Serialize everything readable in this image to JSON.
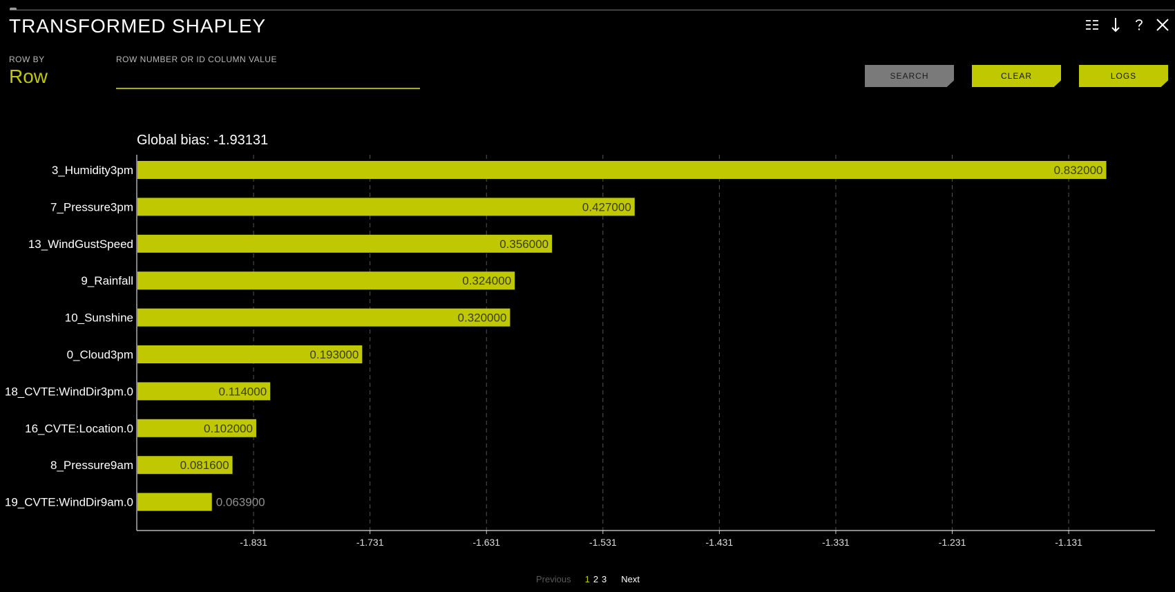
{
  "header": {
    "title": "TRANSFORMED SHAPLEY",
    "controls": [
      {
        "name": "list-icon",
        "symbol": "☷"
      },
      {
        "name": "download-icon",
        "symbol": "↓"
      },
      {
        "name": "help-icon",
        "symbol": "?"
      },
      {
        "name": "close-icon",
        "symbol": "✕"
      }
    ]
  },
  "row_selector": {
    "label": "ROW BY",
    "value": "Row"
  },
  "row_input": {
    "label": "ROW NUMBER OR ID COLUMN VALUE",
    "value": "",
    "placeholder": ""
  },
  "buttons": {
    "search": "SEARCH",
    "clear": "CLEAR",
    "logs": "LOGS"
  },
  "colors": {
    "accent": "#bfc800",
    "button_gray": "#7a7a7a",
    "background": "#000000"
  },
  "chart_data": {
    "type": "bar",
    "orientation": "horizontal",
    "title": "Global bias: -1.93131",
    "base": -1.93131,
    "categories": [
      "3_Humidity3pm",
      "7_Pressure3pm",
      "13_WindGustSpeed",
      "9_Rainfall",
      "10_Sunshine",
      "0_Cloud3pm",
      "18_CVTE:WindDir3pm.0",
      "16_CVTE:Location.0",
      "8_Pressure9am",
      "19_CVTE:WindDir9am.0"
    ],
    "values": [
      0.832,
      0.427,
      0.356,
      0.324,
      0.32,
      0.193,
      0.114,
      0.102,
      0.0816,
      0.0639
    ],
    "value_labels": [
      "0.832000",
      "0.427000",
      "0.356000",
      "0.324000",
      "0.320000",
      "0.193000",
      "0.114000",
      "0.102000",
      "0.081600",
      "0.063900"
    ],
    "x_ticks": [
      -1.831,
      -1.731,
      -1.631,
      -1.531,
      -1.431,
      -1.331,
      -1.231,
      -1.131
    ],
    "x_tick_labels": [
      "-1.831",
      "-1.731",
      "-1.631",
      "-1.531",
      "-1.431",
      "-1.331",
      "-1.231",
      "-1.131"
    ],
    "xlim": [
      -1.93131,
      -1.0569
    ],
    "grid": "vertical dashed",
    "xlabel": "",
    "ylabel": ""
  },
  "pagination": {
    "previous": "Previous",
    "pages": [
      "1",
      "2",
      "3"
    ],
    "current": "1",
    "next": "Next"
  }
}
